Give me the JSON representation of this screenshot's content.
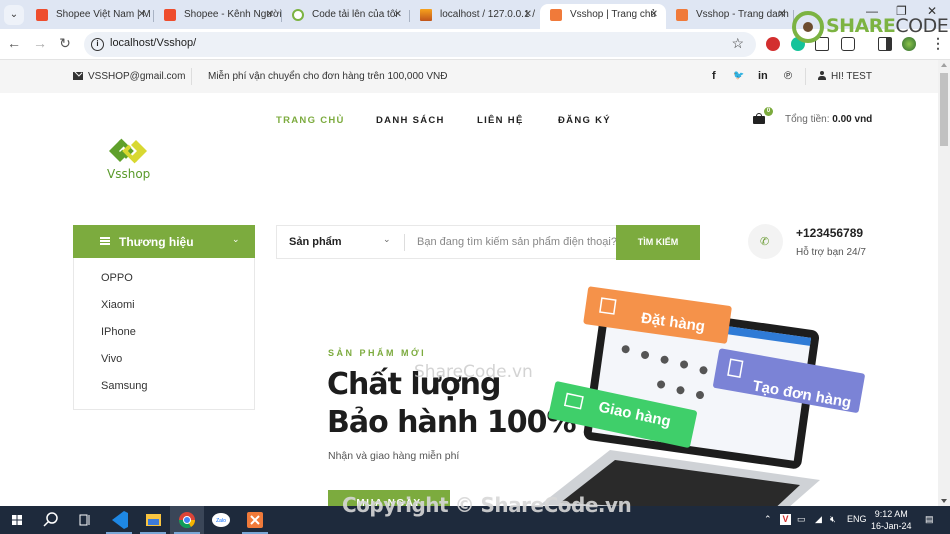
{
  "browser": {
    "tabs": [
      {
        "title": "Shopee Việt Nam | M",
        "favicon": "shopee",
        "active": false
      },
      {
        "title": "Shopee - Kênh Người",
        "favicon": "shopee",
        "active": false
      },
      {
        "title": "Code tải lên của tôi",
        "favicon": "sharecode",
        "active": false
      },
      {
        "title": "localhost / 127.0.0.1 /",
        "favicon": "phpmyadmin",
        "active": false
      },
      {
        "title": "Vsshop | Trang chủ",
        "favicon": "xampp",
        "active": true
      },
      {
        "title": "Vsshop - Trang danh",
        "favicon": "xampp",
        "active": false
      }
    ],
    "url": "localhost/Vsshop/",
    "window_controls": {
      "minimize": "—",
      "restore": "❐",
      "close": "✕"
    }
  },
  "topbar": {
    "email": "VSSHOP@gmail.com",
    "shipping_notice": "Miễn phí vận chuyển cho đơn hàng trên 100,000 VNĐ",
    "social": [
      "f",
      "🐦",
      "in",
      "℗"
    ],
    "greeting": "HI! TEST"
  },
  "logo": {
    "brand": "Vsshop"
  },
  "nav": {
    "items": [
      {
        "label": "TRANG CHỦ",
        "active": true
      },
      {
        "label": "DANH SÁCH",
        "active": false
      },
      {
        "label": "LIÊN HỆ",
        "active": false
      },
      {
        "label": "ĐĂNG KÝ",
        "active": false
      }
    ]
  },
  "cart": {
    "count": "0",
    "total_label": "Tổng tiền:",
    "total_value": "0.00 vnd"
  },
  "categories": {
    "title": "Thương hiệu",
    "items": [
      "OPPO",
      "Xiaomi",
      "IPhone",
      "Vivo",
      "Samsung"
    ]
  },
  "search": {
    "category": "Sản phẩm",
    "placeholder": "Bạn đang tìm kiếm sản phẩm điện thoại?",
    "button": "TÌM KIẾM"
  },
  "support": {
    "phone": "+123456789",
    "subtitle": "Hỗ trợ bạn 24/7"
  },
  "hero": {
    "tag": "SẢN PHẨM MỚI",
    "title_line1": "Chất lượng",
    "title_line2": "Bảo hành 100%",
    "subtitle": "Nhận và giao hàng miễn phí",
    "button": "MUA NGAY",
    "badges": [
      "Đặt hàng",
      "Giao hàng",
      "Tạo đơn hàng"
    ],
    "colors": {
      "order": "#f5924a",
      "ship": "#3fcf6a",
      "create": "#7b83d6"
    }
  },
  "watermarks": {
    "center": "ShareCode.vn",
    "bottom": "Copyright © ShareCode.vn",
    "logo_green": "SHARE",
    "logo_dark": "CODE.vn"
  },
  "taskbar": {
    "apps": [
      "start",
      "search",
      "task-view",
      "vscode",
      "file-explorer",
      "chrome",
      "zalo",
      "xampp"
    ],
    "tray_lang": "ENG",
    "time": "9:12 AM",
    "date": "16-Jan-24"
  },
  "colors": {
    "accent": "#7cab3e",
    "taskbar": "#1e2a3c"
  }
}
